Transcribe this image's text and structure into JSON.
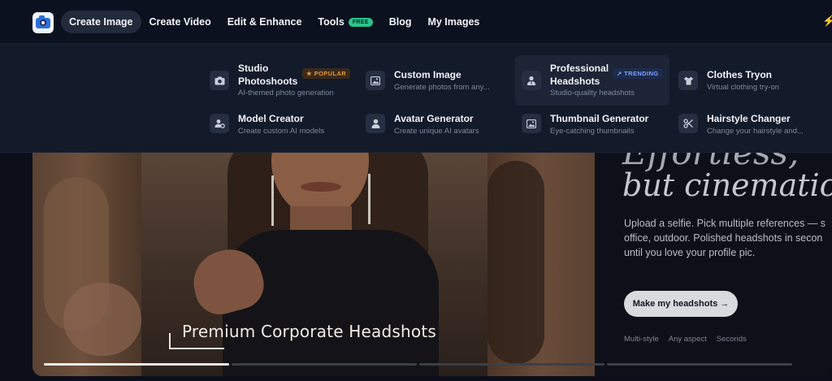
{
  "nav": {
    "items": [
      {
        "label": "Create Image",
        "active": true
      },
      {
        "label": "Create Video"
      },
      {
        "label": "Edit & Enhance"
      },
      {
        "label": "Tools",
        "badge": "FREE"
      },
      {
        "label": "Blog"
      },
      {
        "label": "My Images"
      }
    ]
  },
  "menu": {
    "items": [
      {
        "title": "Studio Photoshoots",
        "title_l1": "Studio",
        "title_l2": "Photoshoots",
        "desc": "AI-themed photo generation",
        "badge": "★ POPULAR",
        "icon": "camera-icon"
      },
      {
        "title": "Custom Image",
        "desc": "Generate photos from any...",
        "icon": "image-icon"
      },
      {
        "title": "Professional Headshots",
        "title_l1": "Professional",
        "title_l2": "Headshots",
        "desc": "Studio-quality headshots",
        "badge": "↗ TRENDING",
        "icon": "person-tie-icon"
      },
      {
        "title": "Clothes Tryon",
        "desc": "Virtual clothing try-on",
        "icon": "shirt-icon"
      },
      {
        "title": "Model Creator",
        "desc": "Create custom AI models",
        "icon": "user-gear-icon"
      },
      {
        "title": "Avatar Generator",
        "desc": "Create unique AI avatars",
        "icon": "user-icon"
      },
      {
        "title": "Thumbnail Generator",
        "desc": "Eye-catching thumbnails",
        "icon": "image-icon"
      },
      {
        "title": "Hairstyle Changer",
        "desc": "Change your hairstyle and...",
        "icon": "scissors-icon"
      }
    ]
  },
  "hero": {
    "caption": "Premium Corporate Headshots",
    "headline_partial": "Effortless,",
    "headline": "but cinematic.",
    "desc_lines": [
      "Upload a selfie. Pick multiple references — s",
      "office, outdoor. Polished headshots in secon",
      "until you love your profile pic."
    ],
    "cta": "Make my headshots →",
    "features": [
      "Multi-style",
      "Any aspect",
      "Seconds"
    ],
    "slide_progress": [
      1.0,
      0,
      0,
      0
    ]
  },
  "colors": {
    "accent_free": "#2bc48a",
    "popular": "#e9963c",
    "trending": "#7aa0ff"
  }
}
